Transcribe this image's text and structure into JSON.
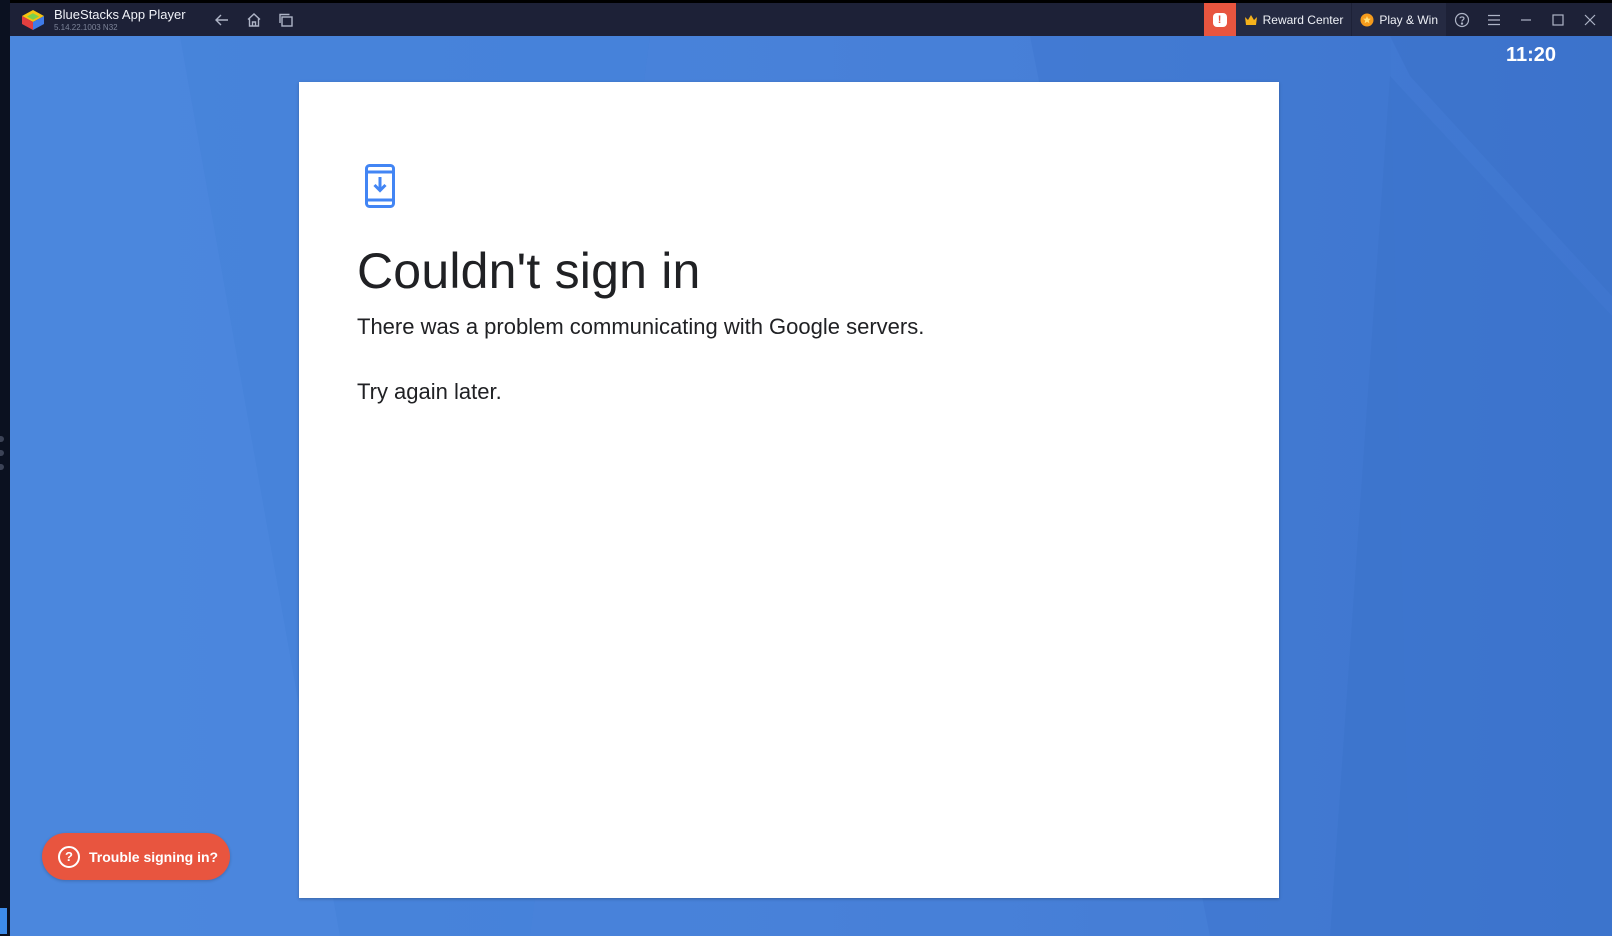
{
  "window": {
    "app_name": "BlueStacks App Player",
    "version": "5.14.22.1003 N32",
    "reward_center_label": "Reward Center",
    "play_win_label": "Play & Win",
    "alert_badge": "!"
  },
  "icons": {
    "back": "back-arrow-icon",
    "home": "home-icon",
    "recents": "recent-apps-icon",
    "help": "help-icon",
    "menu": "hamburger-menu-icon",
    "minimize": "minimize-icon",
    "maximize": "maximize-icon",
    "close": "close-icon",
    "phone_download": "phone-download-icon"
  },
  "status_bar": {
    "time": "11:20"
  },
  "dialog": {
    "title": "Couldn't sign in",
    "message": "There was a problem communicating with Google servers.",
    "message2": "Try again later."
  },
  "help_button": {
    "icon": "?",
    "label": "Trouble signing in?"
  },
  "colors": {
    "titlebar": "#1d2137",
    "accent_red": "#e8553f",
    "screen_blue": "#4780d9",
    "icon_blue": "#4285f4"
  }
}
